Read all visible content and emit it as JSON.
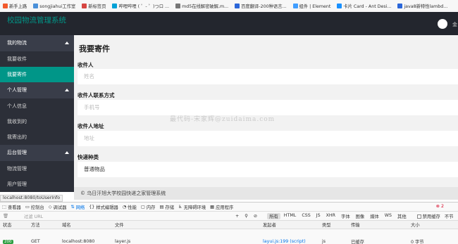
{
  "bookmarks": [
    {
      "label": "新手上路",
      "color": "#f25a2c"
    },
    {
      "label": "songjiahui工作室",
      "color": "#4a90d9"
    },
    {
      "label": "新标签页",
      "color": "#d64541"
    },
    {
      "label": "哔哩哔哩 ( ゜- ゜)つロ ...",
      "color": "#00a1d6"
    },
    {
      "label": "md5在线解密破解,m...",
      "color": "#777777"
    },
    {
      "label": "百度翻译-200种语言...",
      "color": "#2b66d9"
    },
    {
      "label": "组件 | Element",
      "color": "#409eff"
    },
    {
      "label": "卡片 Card - Ant Desi...",
      "color": "#1890ff"
    },
    {
      "label": "java8新特性lambd...",
      "color": "#2b66d9"
    }
  ],
  "app": {
    "title": "校园物流管理系统",
    "username": "金",
    "accent_color": "#009688"
  },
  "sidebar": {
    "groups": [
      {
        "label": "我的物流",
        "items": [
          "我要收件",
          "我要寄件"
        ]
      },
      {
        "label": "个人管理",
        "items": [
          "个人信息",
          "我收到的",
          "我寄出的"
        ]
      },
      {
        "label": "后台管理",
        "items": [
          "物流管理",
          "用户管理"
        ]
      }
    ],
    "active_item": "我要寄件"
  },
  "main": {
    "title": "我要寄件",
    "fields": [
      {
        "label": "收件人",
        "placeholder": "姓名",
        "value": ""
      },
      {
        "label": "收件人联系方式",
        "placeholder": "手机号",
        "value": ""
      },
      {
        "label": "收件人地址",
        "placeholder": "地址",
        "value": ""
      },
      {
        "label": "快递种类",
        "placeholder": "",
        "value": "普通物品"
      }
    ],
    "watermark": "最代码-宋家辉@zuidaima.com"
  },
  "footer": {
    "text": "© 乌日汗旭大学校园快递之家管理系统"
  },
  "status_url": "localhost:8080/toUserInfo",
  "devtools": {
    "tabs": [
      {
        "label": "查看器",
        "icon": "inspector-icon"
      },
      {
        "label": "控制台",
        "icon": "console-icon"
      },
      {
        "label": "调试器",
        "icon": "debugger-icon"
      },
      {
        "label": "网络",
        "icon": "network-icon",
        "active": true
      },
      {
        "label": "样式编辑器",
        "icon": "style-editor-icon"
      },
      {
        "label": "性能",
        "icon": "performance-icon"
      },
      {
        "label": "内存",
        "icon": "memory-icon"
      },
      {
        "label": "存储",
        "icon": "storage-icon"
      },
      {
        "label": "无障碍环境",
        "icon": "accessibility-icon"
      },
      {
        "label": "应用程序",
        "icon": "application-icon"
      }
    ],
    "error_count": "2",
    "filter_placeholder": "过滤 URL",
    "type_filters": [
      "所有",
      "HTML",
      "CSS",
      "JS",
      "XHR",
      "字体",
      "图像",
      "媒体",
      "WS",
      "其他"
    ],
    "active_type": "所有",
    "options": {
      "disable_cache": "禁用缓存",
      "no_throttle": "不节"
    },
    "columns": [
      "状态",
      "方法",
      "域名",
      "文件",
      "发起者",
      "类型",
      "传输",
      "大小"
    ],
    "rows": [
      {
        "status": "200",
        "method": "GET",
        "domain": "localhost:8080",
        "file": "layer.js",
        "initiator": "layui.js:199 (script)",
        "type": "js",
        "transferred": "已缓存",
        "size": "0 字节"
      }
    ]
  }
}
